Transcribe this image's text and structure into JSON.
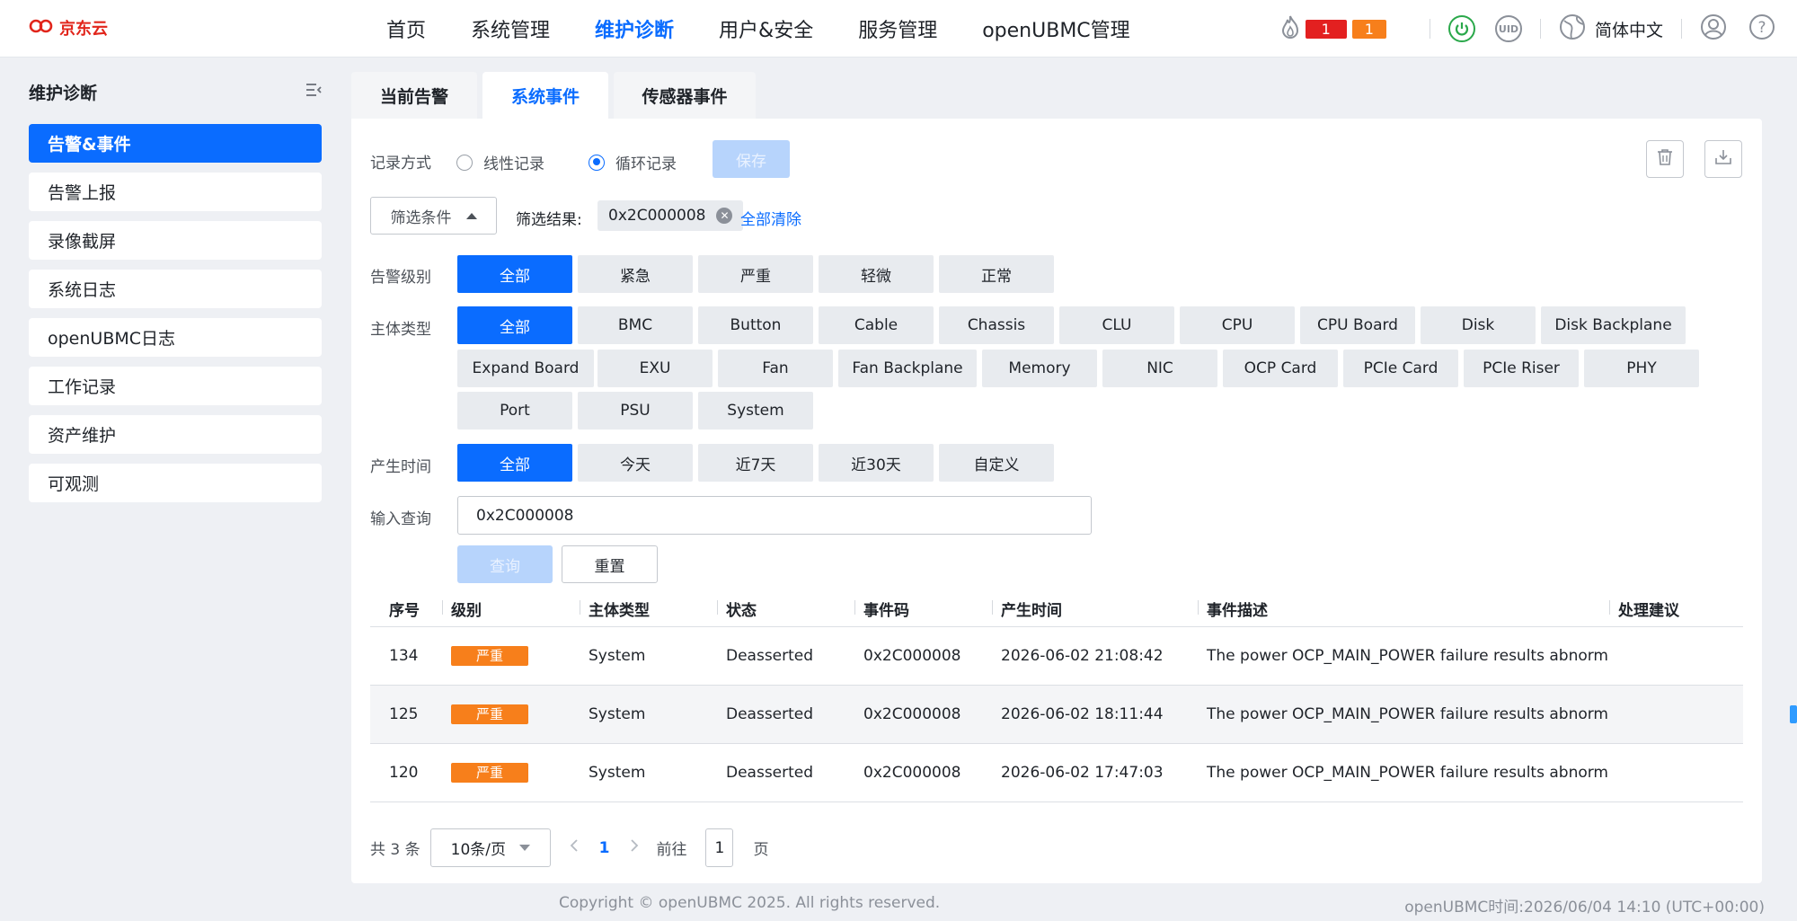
{
  "header": {
    "logo_text": "京东云",
    "nav": [
      "首页",
      "系统管理",
      "维护诊断",
      "用户&安全",
      "服务管理",
      "openUBMC管理"
    ],
    "active_nav": "维护诊断",
    "alarm_critical_count": "1",
    "alarm_major_count": "1",
    "uid_label": "UID",
    "language": "简体中文"
  },
  "sidebar": {
    "title": "维护诊断",
    "items": [
      {
        "label": "告警&事件",
        "active": true
      },
      {
        "label": "告警上报"
      },
      {
        "label": "录像截屏"
      },
      {
        "label": "系统日志"
      },
      {
        "label": "openUBMC日志"
      },
      {
        "label": "工作记录"
      },
      {
        "label": "资产维护"
      },
      {
        "label": "可观测"
      }
    ]
  },
  "tabs": [
    "当前告警",
    "系统事件",
    "传感器事件"
  ],
  "record": {
    "label": "记录方式",
    "options": [
      "线性记录",
      "循环记录"
    ],
    "selected": "循环记录",
    "save_label": "保存"
  },
  "filter": {
    "button_label": "筛选条件",
    "result_label": "筛选结果:",
    "chip_value": "0x2C000008",
    "clear_all": "全部清除"
  },
  "level": {
    "label": "告警级别",
    "options": [
      "全部",
      "紧急",
      "严重",
      "轻微",
      "正常"
    ],
    "selected": "全部"
  },
  "subject": {
    "label": "主体类型",
    "options": [
      "全部",
      "BMC",
      "Button",
      "Cable",
      "Chassis",
      "CLU",
      "CPU",
      "CPU Board",
      "Disk",
      "Disk Backplane",
      "Expand Board",
      "EXU",
      "Fan",
      "Fan Backplane",
      "Memory",
      "NIC",
      "OCP Card",
      "PCIe Card",
      "PCIe Riser",
      "PHY",
      "Port",
      "PSU",
      "System"
    ],
    "selected": "全部"
  },
  "time": {
    "label": "产生时间",
    "options": [
      "全部",
      "今天",
      "近7天",
      "近30天",
      "自定义"
    ],
    "selected": "全部"
  },
  "query": {
    "label": "输入查询",
    "value": "0x2C000008",
    "search_label": "查询",
    "reset_label": "重置"
  },
  "table": {
    "headers": [
      "序号",
      "级别",
      "主体类型",
      "状态",
      "事件码",
      "产生时间",
      "事件描述",
      "处理建议"
    ],
    "rows": [
      {
        "id": "134",
        "level": "严重",
        "subject": "System",
        "state": "Deasserted",
        "code": "0x2C000008",
        "time": "2026-06-02 21:08:42",
        "desc": "The power OCP_MAIN_POWER failure results abnormal...",
        "advice": ""
      },
      {
        "id": "125",
        "level": "严重",
        "subject": "System",
        "state": "Deasserted",
        "code": "0x2C000008",
        "time": "2026-06-02 18:11:44",
        "desc": "The power OCP_MAIN_POWER failure results abnormal...",
        "advice": ""
      },
      {
        "id": "120",
        "level": "严重",
        "subject": "System",
        "state": "Deasserted",
        "code": "0x2C000008",
        "time": "2026-06-02 17:47:03",
        "desc": "The power OCP_MAIN_POWER failure results abnormal...",
        "advice": ""
      }
    ]
  },
  "pager": {
    "total": "共 3 条",
    "page_size": "10条/页",
    "current_page": "1",
    "goto_label": "前往",
    "goto_value": "1",
    "page_suffix": "页"
  },
  "footer": {
    "copyright": "Copyright © openUBMC 2025. All rights reserved.",
    "time": "openUBMC时间:2026/06/04 14:10 (UTC+00:00)"
  },
  "colors": {
    "primary": "#0a6cff",
    "critical": "#e32020",
    "major": "#f77f1b",
    "power_on": "#2aa84a"
  }
}
